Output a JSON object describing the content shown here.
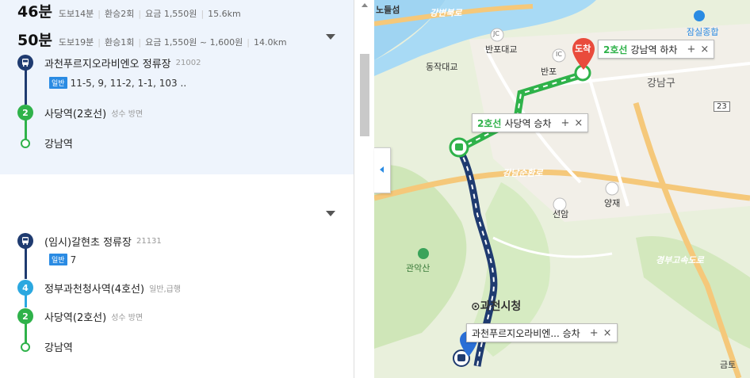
{
  "routes": [
    {
      "time": "50분",
      "walk": "도보19분",
      "transfer": "환승1회",
      "fare": "요금 1,550원 ~ 1,600원",
      "distance": "14.0km",
      "steps": {
        "bus_stop": "과천푸르지오라비엔오 정류장",
        "bus_stop_id": "21002",
        "bus_tag": "일반",
        "bus_lines": "11-5, 9, 11-2, 1-1, 103 ..",
        "subway_badge": "2",
        "subway_station": "사당역(2호선)",
        "subway_dir": "성수 방면",
        "end": "강남역"
      }
    },
    {
      "time": "46분",
      "walk": "도보14분",
      "transfer": "환승2회",
      "fare": "요금 1,550원",
      "distance": "15.6km",
      "steps": {
        "bus_stop": "(임시)갈현초 정류장",
        "bus_stop_id": "21131",
        "bus_tag": "일반",
        "bus_lines": "7",
        "line4_badge": "4",
        "line4_station": "정부과천청사역(4호선)",
        "line4_info": "일반,급행",
        "subway_badge": "2",
        "subway_station": "사당역(2호선)",
        "subway_dir": "성수 방면",
        "end": "강남역"
      }
    }
  ],
  "map": {
    "labels": {
      "nodeulseom": "노들섬",
      "gangbuk": "강변북로",
      "banpo_bridge": "반포대교",
      "banpo": "반포",
      "dongjak_bridge": "동작대교",
      "gangnam_gu": "강남구",
      "jamsil": "잠실종합",
      "road23": "23",
      "sunhwan": "강남순환로",
      "seonam": "선암",
      "yangjae": "양재",
      "gwanaksan": "관악산",
      "gwacheon": "⊙과천시청",
      "gyeongbu": "경부고속도로",
      "geumto": "금토",
      "ic": "IC",
      "jc": "JC"
    },
    "arrival_pin": "도착",
    "popups": {
      "arrive_line": "2호선",
      "arrive_name": "강남역 하차",
      "transfer_line": "2호선",
      "transfer_name": "사당역 승차",
      "board_name": "과천푸르지오라비엔... 승차",
      "plus": "+",
      "close": "×"
    }
  },
  "colors": {
    "bus_navy": "#1f3b70",
    "line2_green": "#2fb24a",
    "line4_blue": "#2ba8e0",
    "arrival_red": "#e94b3c",
    "bus_tag_blue": "#2a8be3"
  }
}
